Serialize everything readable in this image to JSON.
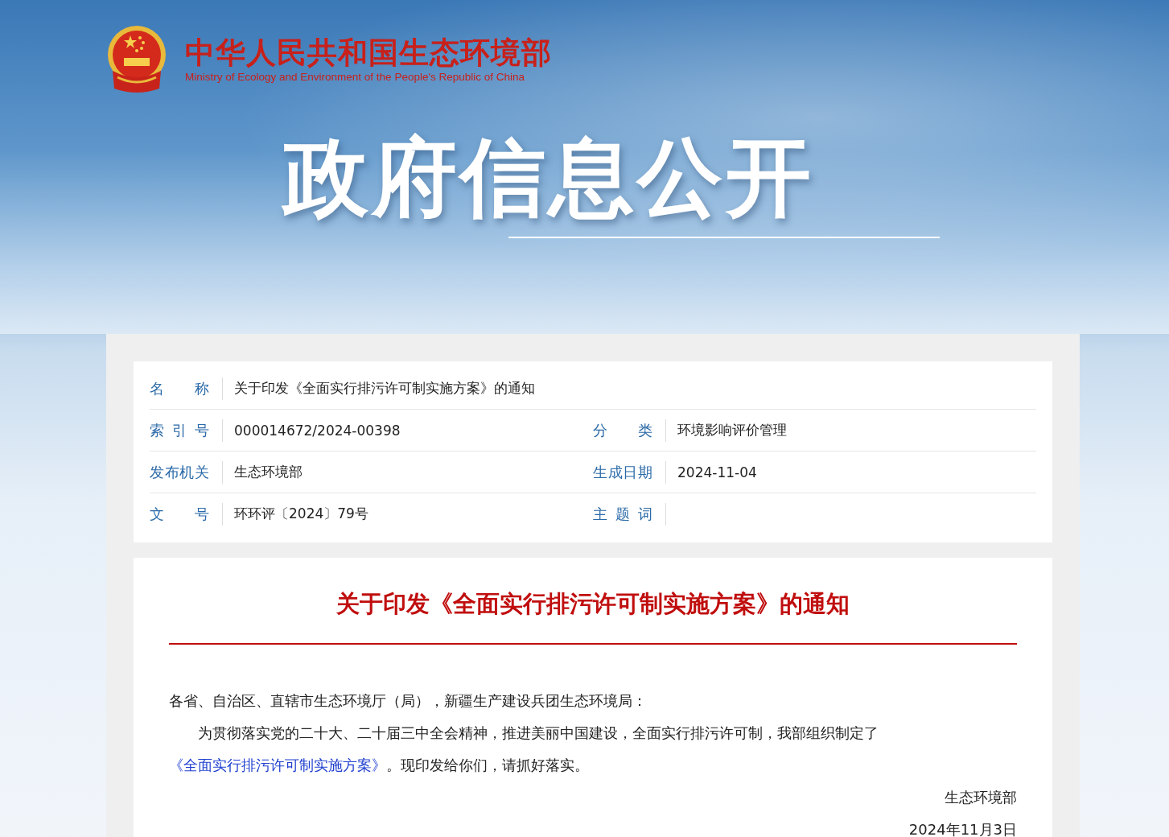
{
  "header": {
    "site_name": "中华人民共和国生态环境部",
    "site_name_en": "Ministry of Ecology and Environment of the People's Republic of China",
    "banner_title": "政府信息公开"
  },
  "info": {
    "rows": [
      [
        {
          "label": "名称",
          "value": "关于印发《全面实行排污许可制实施方案》的通知"
        }
      ],
      [
        {
          "label": "索引号",
          "value": "000014672/2024-00398"
        },
        {
          "label": "分类",
          "value": "环境影响评价管理"
        }
      ],
      [
        {
          "label": "发布机关",
          "value": "生态环境部"
        },
        {
          "label": "生成日期",
          "value": "2024-11-04"
        }
      ],
      [
        {
          "label": "文号",
          "value": "环环评〔2024〕79号"
        },
        {
          "label": "主题词"
        }
      ]
    ]
  },
  "article": {
    "title": "关于印发《全面实行排污许可制实施方案》的通知",
    "salutation": "各省、自治区、直辖市生态环境厅（局），新疆生产建设兵团生态环境局：",
    "body": {
      "text_before": "为贯彻落实党的二十大、二十届三中全会精神，推进美丽中国建设，全面实行排污许可制，我部组织制定了",
      "link": "《全面实行排污许可制实施方案》",
      "text_after": "。现印发给你们，请抓好落实。"
    },
    "signature": "生态环境部",
    "date": "2024年11月3日"
  }
}
